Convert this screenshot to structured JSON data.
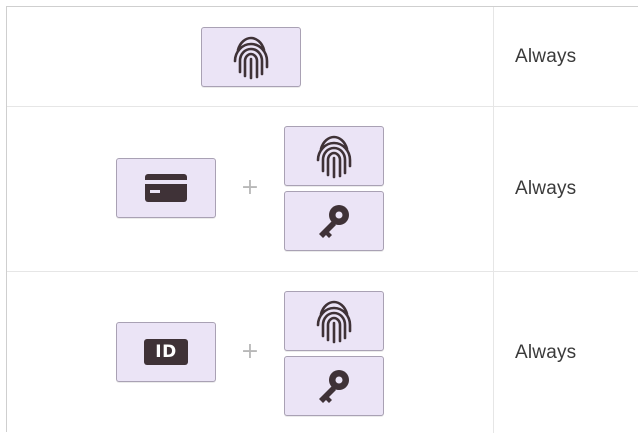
{
  "table": {
    "rows": [
      {
        "factors": [
          "fingerprint-icon"
        ],
        "time_restriction": "Always"
      },
      {
        "factors": [
          "card-icon",
          "plus",
          "fingerprint-icon",
          "key-icon"
        ],
        "plus_symbol": "+",
        "time_restriction": "Always"
      },
      {
        "factors": [
          "id-badge-icon",
          "plus",
          "fingerprint-icon",
          "key-icon"
        ],
        "plus_symbol": "+",
        "id_label": "ID",
        "time_restriction": "Always"
      }
    ]
  },
  "colors": {
    "tile_background": "#ebe4f6",
    "tile_border": "#a9a1b4",
    "icon_dark": "#3f3237",
    "plus_gray": "#b8b8b8",
    "text": "#3a3a3a"
  }
}
